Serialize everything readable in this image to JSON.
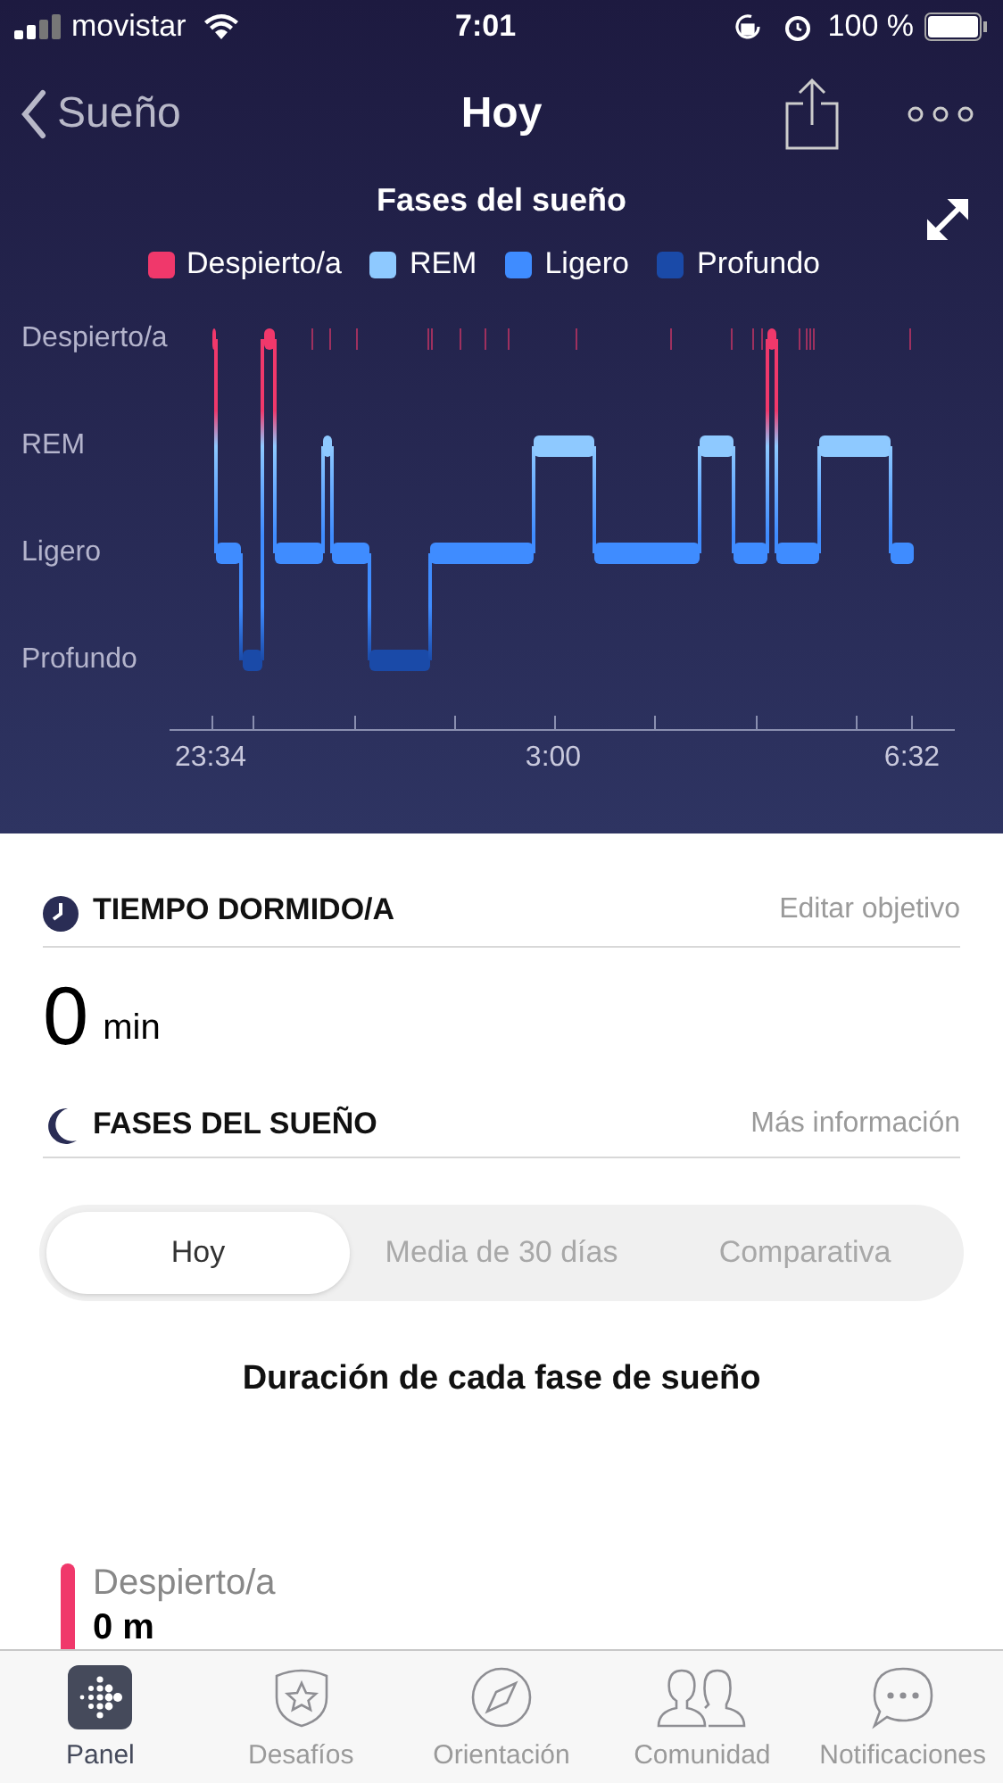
{
  "status_bar": {
    "carrier": "movistar",
    "time": "7:01",
    "battery": "100 %"
  },
  "nav": {
    "back": "Sueño",
    "title": "Hoy"
  },
  "chart": {
    "title": "Fases del sueño",
    "legend": [
      {
        "label": "Despierto/a",
        "color": "#f0386b"
      },
      {
        "label": "REM",
        "color": "#8ec9ff"
      },
      {
        "label": "Ligero",
        "color": "#3f8cff"
      },
      {
        "label": "Profundo",
        "color": "#1a4aa8"
      }
    ],
    "y_labels": [
      "Despierto/a",
      "REM",
      "Ligero",
      "Profundo"
    ],
    "x_labels": [
      "23:34",
      "3:00",
      "6:32"
    ]
  },
  "asleep": {
    "title": "TIEMPO DORMIDO/A",
    "link": "Editar objetivo",
    "value": "0",
    "unit": "min"
  },
  "phases": {
    "title": "FASES DEL SUEÑO",
    "link": "Más información",
    "tabs": [
      {
        "label": "Hoy",
        "selected": true
      },
      {
        "label": "Media de 30 días",
        "selected": false
      },
      {
        "label": "Comparativa",
        "selected": false
      }
    ],
    "subtitle": "Duración de cada fase de sueño",
    "items": [
      {
        "label": "Despierto/a",
        "value": "0 m",
        "color": "#f0386b"
      }
    ]
  },
  "tab_bar": [
    {
      "label": "Panel",
      "kind": "panel",
      "selected": true
    },
    {
      "label": "Desafíos",
      "kind": "badge",
      "selected": false
    },
    {
      "label": "Orientación",
      "kind": "compass",
      "selected": false
    },
    {
      "label": "Comunidad",
      "kind": "people",
      "selected": false
    },
    {
      "label": "Notificaciones",
      "kind": "chat",
      "selected": false
    }
  ]
}
